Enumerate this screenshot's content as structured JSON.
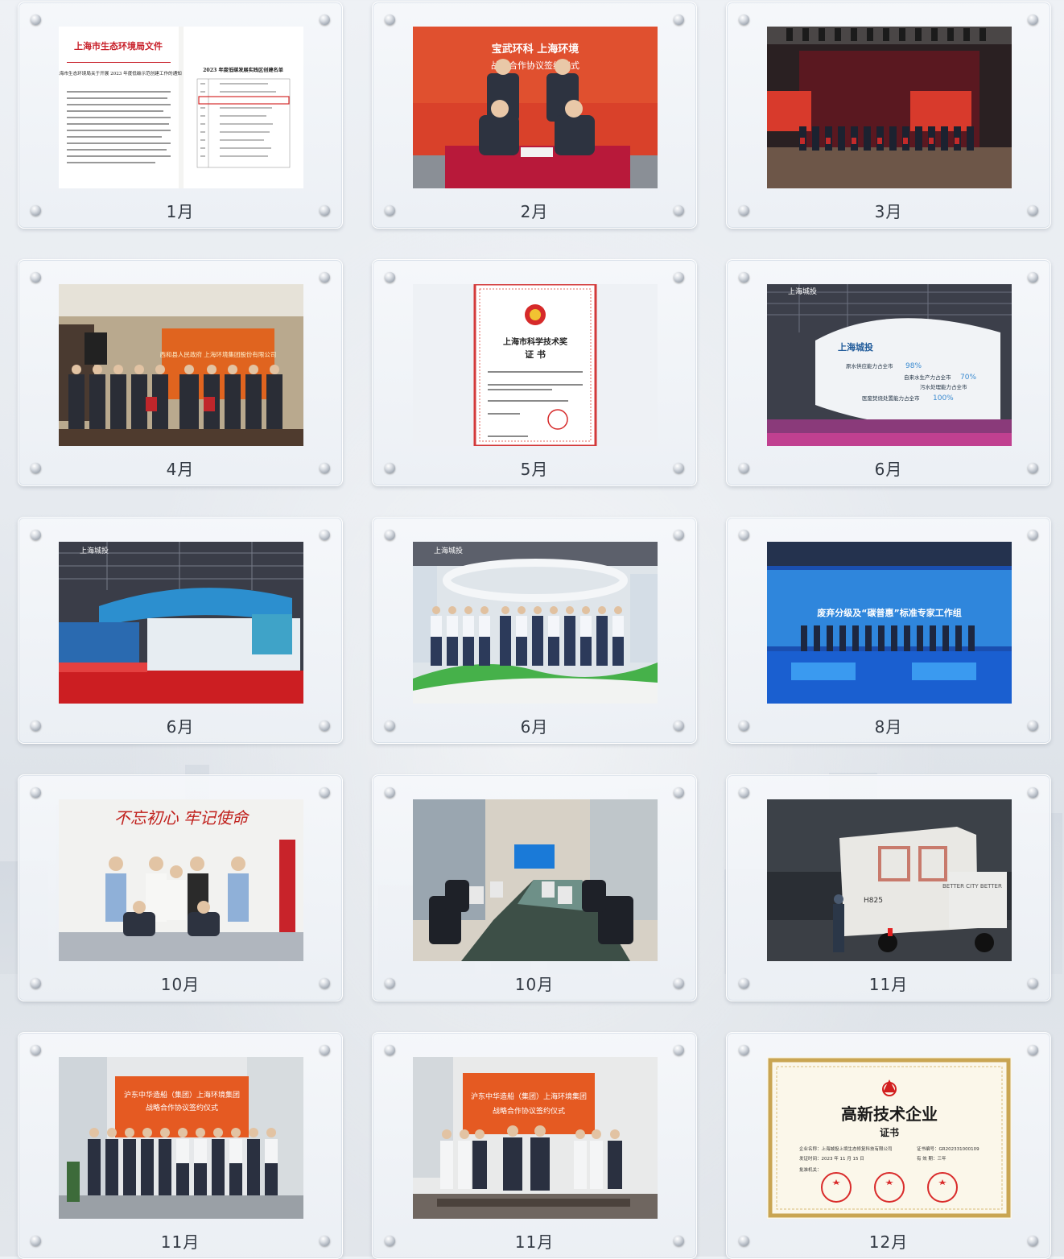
{
  "cards": [
    {
      "caption": "1月",
      "photo": "document-notice-image"
    },
    {
      "caption": "2月",
      "photo": "signing-ceremony-photo"
    },
    {
      "caption": "3月",
      "photo": "stage-award-photo"
    },
    {
      "caption": "4月",
      "photo": "group-signing-photo"
    },
    {
      "caption": "5月",
      "photo": "award-certificate-image"
    },
    {
      "caption": "6月",
      "photo": "exhibition-booth-photo"
    },
    {
      "caption": "6月",
      "photo": "exhibition-hall-photo"
    },
    {
      "caption": "6月",
      "photo": "booth-group-photo"
    },
    {
      "caption": "8月",
      "photo": "stage-expert-group-photo"
    },
    {
      "caption": "10月",
      "photo": "party-signing-photo"
    },
    {
      "caption": "10月",
      "photo": "meeting-room-photo"
    },
    {
      "caption": "11月",
      "photo": "night-truck-photo"
    },
    {
      "caption": "11月",
      "photo": "shipyard-group-photo"
    },
    {
      "caption": "11月",
      "photo": "handshake-photo"
    },
    {
      "caption": "12月",
      "photo": "high-tech-certificate-image"
    }
  ],
  "texts": {
    "doc_header": "上海市生态环境局文件",
    "doc_title": "上海市生态环境局关于开展 2023 年度低碳示范创建工作的通知",
    "doc_list_title": "2023 年度低碳发展实践区创建名单",
    "banner_feb": "宝武环科 上海环境",
    "banner_feb_2": "战略合作协议签约仪式",
    "banner_apr": "西和县人民政府 上海环境集团股份有限公司",
    "cert_may_title": "上海市科学技术奖",
    "cert_may_sub": "证  书",
    "expo_logo": "上海城投",
    "expo_stat_1": "原水供应能力占全市",
    "expo_stat_1_val": "98%",
    "expo_stat_2": "自来水生产力占全市",
    "expo_stat_2_val": "70%",
    "expo_stat_3": "污水处理能力占全市",
    "expo_stat_4": "医废焚烧处置能力占全市",
    "expo_stat_4_val": "100%",
    "stage_aug": "废弃分级及“碳普惠”标准专家工作组",
    "slogan_oct": "不忘初心 牢记使命",
    "truck_plate": "H825",
    "truck_text": "BETTER CITY BETTER",
    "banner_nov": "沪东中华造船（集团）上海环境集团",
    "banner_nov_2": "战略合作协议签约仪式",
    "cert_dec_title": "高新技术企业",
    "cert_dec_sub": "证书",
    "cert_dec_company": "企业名称：上海城投上境生态修复科技有限公司",
    "cert_dec_no": "证书编号：GR202331000109",
    "cert_dec_date": "发证时间：2023 年 11 月 15 日",
    "cert_dec_valid": "有 效 期：三年",
    "cert_dec_issuer": "批准机关："
  }
}
